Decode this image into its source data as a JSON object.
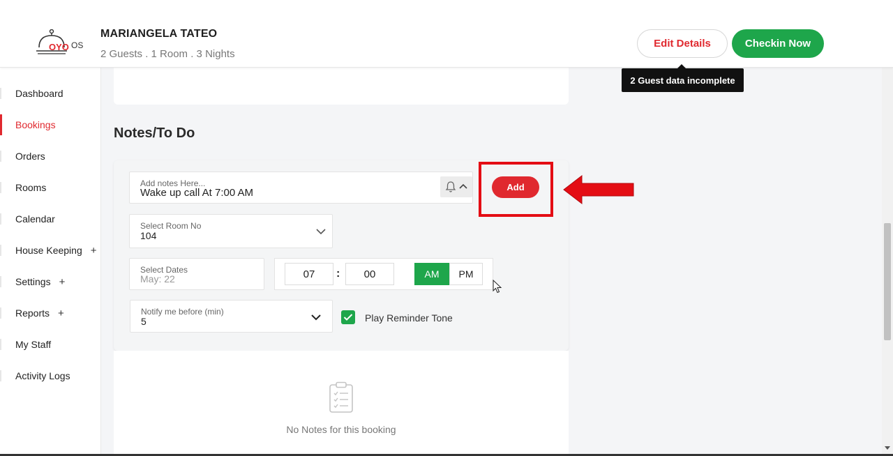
{
  "header": {
    "logo_text": "OYO",
    "logo_suffix": "OS",
    "guest_name": "MARIANGELA TATEO",
    "guest_meta": "2 Guests . 1 Room . 3 Nights",
    "edit_label": "Edit Details",
    "checkin_label": "Checkin Now",
    "tooltip": "2 Guest data incomplete"
  },
  "sidebar": {
    "items": [
      {
        "label": "Dashboard"
      },
      {
        "label": "Bookings"
      },
      {
        "label": "Orders"
      },
      {
        "label": "Rooms"
      },
      {
        "label": "Calendar"
      },
      {
        "label": "House Keeping",
        "plus": "+"
      },
      {
        "label": "Settings",
        "plus": "+"
      },
      {
        "label": "Reports",
        "plus": "+"
      },
      {
        "label": "My Staff"
      },
      {
        "label": "Activity Logs"
      }
    ],
    "active": "Bookings"
  },
  "notes": {
    "section_title": "Notes/To Do",
    "input_placeholder": "Add notes Here...",
    "input_value": "Wake up call At 7:00 AM",
    "add_label": "Add",
    "room_label": "Select Room No",
    "room_value": "104",
    "dates_label": "Select Dates",
    "dates_value": "May: 22",
    "hour": "07",
    "colon": ":",
    "minute": "00",
    "am": "AM",
    "pm": "PM",
    "selected_period": "AM",
    "notify_label": "Notify me before (min)",
    "notify_value": "5",
    "reminder_label": "Play Reminder Tone",
    "reminder_checked": true,
    "empty_text": "No Notes for this booking"
  },
  "colors": {
    "accent_red": "#e0292f",
    "accent_green": "#1ea64b",
    "highlight_red": "#e40d14"
  }
}
